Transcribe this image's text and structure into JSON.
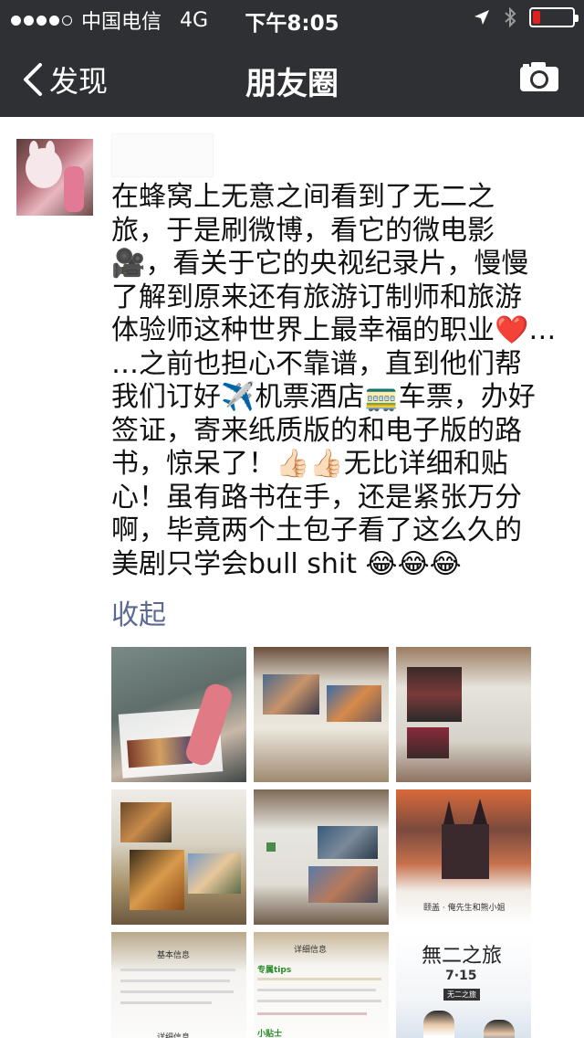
{
  "status_bar": {
    "carrier": "中国电信",
    "network": "4G",
    "time": "下午8:05",
    "signal_bars": 4,
    "battery_level": 0.18,
    "icons": [
      "location-arrow-icon",
      "bluetooth-icon",
      "battery-icon"
    ]
  },
  "nav": {
    "back_label": "发现",
    "title": "朋友圈",
    "icons": [
      "chevron-left-icon",
      "camera-icon"
    ]
  },
  "post": {
    "lines": [
      "在蜂窝上无意之间看到了无二之",
      "旅，于是刷微博，看它的微电影",
      "🎥，看关于它的央视纪录片，慢慢",
      "了解到原来还有旅游订制师和旅游",
      "体验师这种世界上最幸福的职业❤️…",
      "…之前也担心不靠谱，直到他们帮",
      "我们订好✈️机票酒店🚃车票，办好",
      "签证，寄来纸质版的和电子版的路",
      "书，惊呆了！👍🏻👍🏻无比详细和贴",
      "心！虽有路书在手，还是紧张万分",
      "啊，毕竟两个土包子看了这么久的",
      "美剧只学会bull shit 😂😂😂"
    ],
    "collapse_label": "收起",
    "photo_captions": {
      "p6": "颐盖 · 俺先生和熊小姐",
      "p7": "基本信息",
      "p7b": "详细信息",
      "p8": "详细信息",
      "p8_tips": "专属tips",
      "p8_sub": "小贴士",
      "p9_title": "無二之旅",
      "p9_date": "7·15",
      "p9_brand": "无二之旅"
    }
  }
}
